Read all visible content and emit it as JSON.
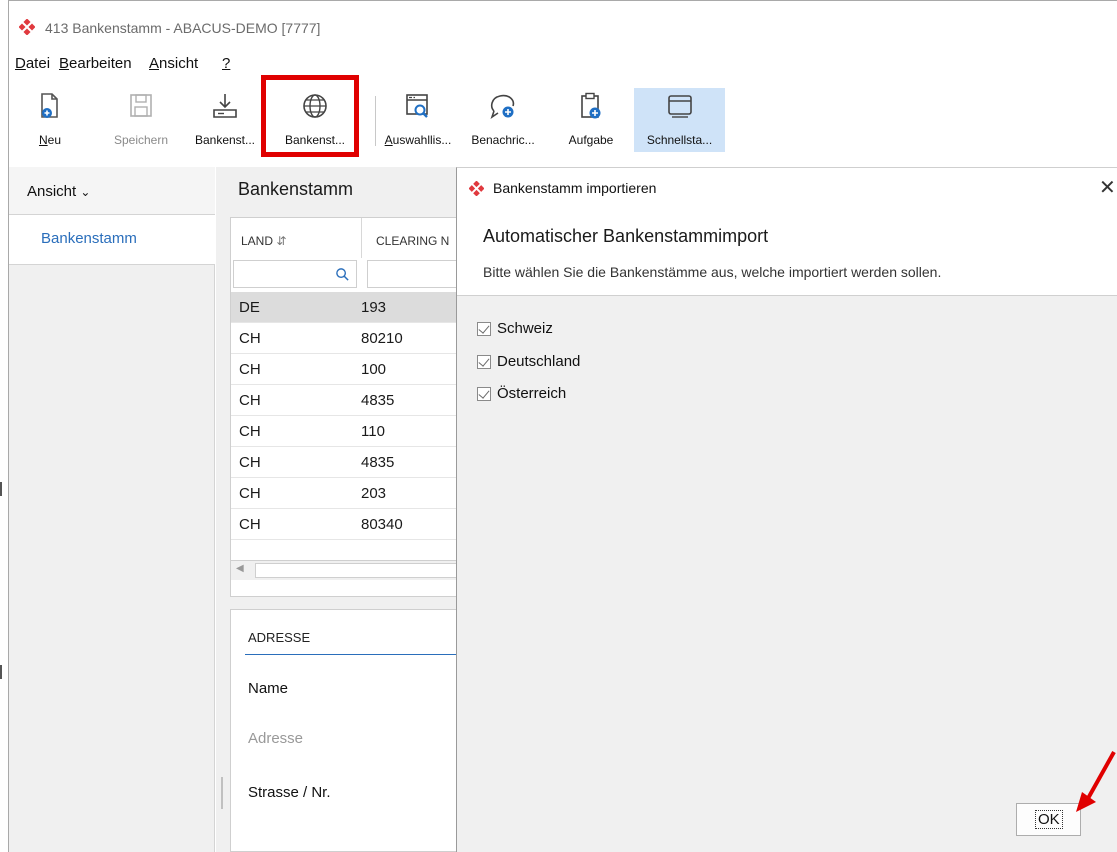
{
  "window": {
    "title": "413 Bankenstamm - ABACUS-DEMO [7777]",
    "brand_color": "#e0393e"
  },
  "menu": {
    "items": [
      {
        "label": "Datei",
        "accel": "D",
        "rest": "atei"
      },
      {
        "label": "Bearbeiten",
        "accel": "B",
        "rest": "earbeiten"
      },
      {
        "label": "Ansicht",
        "accel": "A",
        "rest": "nsicht"
      },
      {
        "label": "?",
        "accel": "?",
        "rest": ""
      }
    ]
  },
  "toolbar": {
    "new_label": "Neu",
    "save_label": "Speichern",
    "bank_download_label": "Bankenst...",
    "bank_import_label": "Bankenst...",
    "selection_list_label": "Auswahllis...",
    "notification_label": "Benachric...",
    "task_label": "Aufgabe",
    "quickstart_label": "Schnellsta..."
  },
  "sidebar": {
    "view_label": "Ansicht",
    "items": [
      {
        "label": "Bankenstamm"
      }
    ]
  },
  "main": {
    "title": "Bankenstamm",
    "columns": [
      "LAND",
      "CLEARING N"
    ],
    "rows": [
      {
        "land": "DE",
        "clearing": "193"
      },
      {
        "land": "CH",
        "clearing": "80210"
      },
      {
        "land": "CH",
        "clearing": "100"
      },
      {
        "land": "CH",
        "clearing": "4835"
      },
      {
        "land": "CH",
        "clearing": "110"
      },
      {
        "land": "CH",
        "clearing": "4835"
      },
      {
        "land": "CH",
        "clearing": "203"
      },
      {
        "land": "CH",
        "clearing": "80340"
      }
    ]
  },
  "detail": {
    "section_label": "ADRESSE",
    "name_label": "Name",
    "address_label": "Adresse",
    "street_label": "Strasse / Nr."
  },
  "dialog": {
    "title": "Bankenstamm importieren",
    "heading": "Automatischer Bankenstammimport",
    "subtitle": "Bitte wählen Sie die Bankenstämme aus, welche importiert werden sollen.",
    "options": [
      {
        "label": "Schweiz",
        "checked": true
      },
      {
        "label": "Deutschland",
        "checked": true
      },
      {
        "label": "Österreich",
        "checked": true
      }
    ],
    "ok_label": "OK"
  },
  "annotation": {
    "highlight_color": "#e00000"
  }
}
